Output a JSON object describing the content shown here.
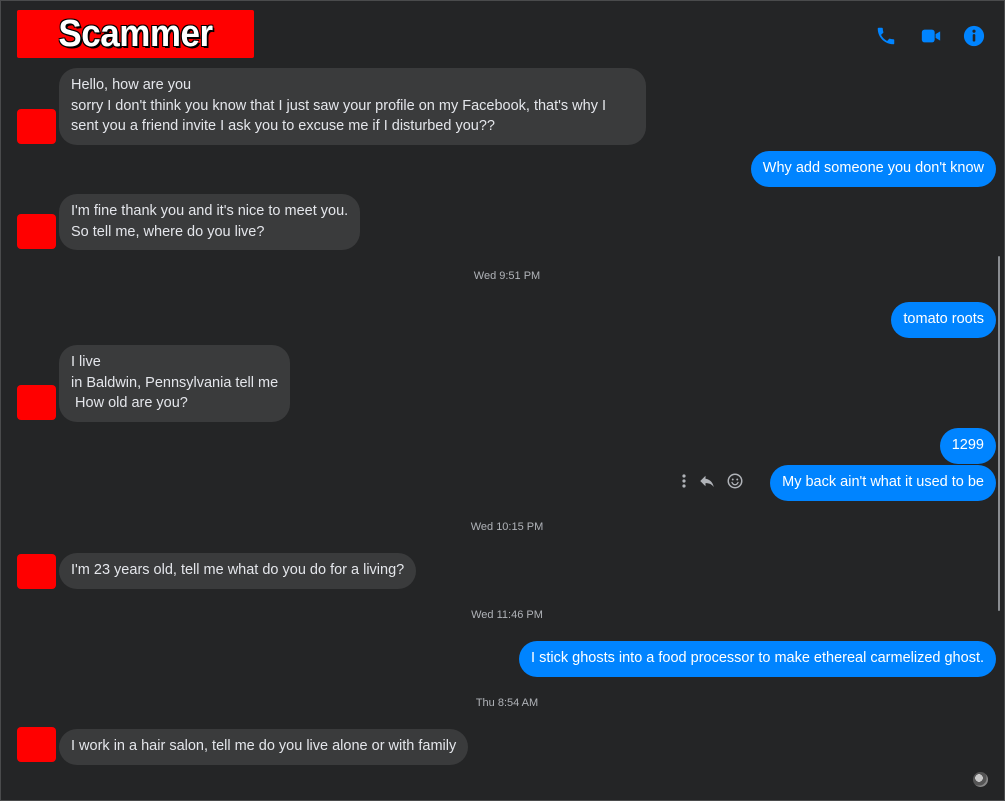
{
  "header": {
    "title": "Scammer",
    "icons": [
      "phone-icon",
      "video-camera-icon",
      "info-icon"
    ],
    "accent_color": "#0084ff",
    "title_bg": "#ff0000"
  },
  "messages": [
    {
      "dir": "in",
      "text": "Hello, how are you\nsorry I don't think you know that I just saw your profile on my Facebook, that's why I\nsent you a friend invite I ask you to excuse me if I disturbed you??"
    },
    {
      "dir": "out",
      "text": "Why add someone you don't know"
    },
    {
      "dir": "in",
      "text": "I'm fine thank you and it's nice to meet you.\nSo tell me, where do you live?"
    },
    {
      "dir": "ts",
      "text": "Wed 9:51 PM"
    },
    {
      "dir": "out",
      "text": "tomato roots"
    },
    {
      "dir": "in",
      "text": "I live\nin Baldwin, Pennsylvania tell me\n How old are you?"
    },
    {
      "dir": "out",
      "text": "1299"
    },
    {
      "dir": "out",
      "text": "My back ain't what it used to be"
    },
    {
      "dir": "ts",
      "text": "Wed 10:15 PM"
    },
    {
      "dir": "in",
      "text": "I'm 23 years old, tell me what do you do for a living?"
    },
    {
      "dir": "ts",
      "text": "Wed 11:46 PM"
    },
    {
      "dir": "out",
      "text": "I stick ghosts into a food processor to make ethereal carmelized ghost."
    },
    {
      "dir": "ts",
      "text": "Thu 8:54 AM"
    },
    {
      "dir": "in",
      "text": "I work in a hair salon, tell me do you live alone or with family"
    }
  ],
  "hover_actions": [
    "more-options-icon",
    "reply-icon",
    "react-emoji-icon"
  ]
}
